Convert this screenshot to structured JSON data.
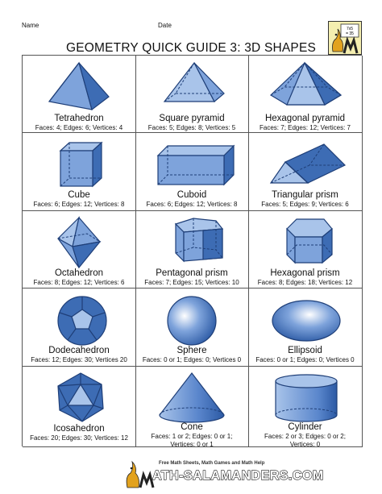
{
  "header": {
    "name_label": "Name",
    "date_label": "Date"
  },
  "title": "GEOMETRY QUICK GUIDE 3:  3D SHAPES",
  "shapes": [
    {
      "name": "Tetrahedron",
      "facts": [
        "Faces: 4; Edges: 6; Vertices: 4"
      ],
      "icon": "tetrahedron-icon"
    },
    {
      "name": "Square pyramid",
      "facts": [
        "Faces: 5; Edges: 8; Vertices: 5"
      ],
      "icon": "square-pyramid-icon"
    },
    {
      "name": "Hexagonal pyramid",
      "facts": [
        "Faces: 7; Edges: 12; Vertices: 7"
      ],
      "icon": "hexagonal-pyramid-icon"
    },
    {
      "name": "Cube",
      "facts": [
        "Faces: 6; Edges: 12; Vertices: 8"
      ],
      "icon": "cube-icon"
    },
    {
      "name": "Cuboid",
      "facts": [
        "Faces: 6; Edges: 12; Vertices: 8"
      ],
      "icon": "cuboid-icon"
    },
    {
      "name": "Triangular prism",
      "facts": [
        "Faces: 5; Edges: 9; Vertices: 6"
      ],
      "icon": "triangular-prism-icon"
    },
    {
      "name": "Octahedron",
      "facts": [
        "Faces: 8; Edges: 12; Vertices: 6"
      ],
      "icon": "octahedron-icon"
    },
    {
      "name": "Pentagonal prism",
      "facts": [
        "Faces: 7; Edges: 15; Vertices: 10"
      ],
      "icon": "pentagonal-prism-icon"
    },
    {
      "name": "Hexagonal prism",
      "facts": [
        "Faces: 8; Edges: 18; Vertices: 12"
      ],
      "icon": "hexagonal-prism-icon"
    },
    {
      "name": "Dodecahedron",
      "facts": [
        "Faces: 12; Edges: 30; Vertices 20"
      ],
      "icon": "dodecahedron-icon"
    },
    {
      "name": "Sphere",
      "facts": [
        "Faces: 0 or 1; Edges: 0; Vertices 0"
      ],
      "icon": "sphere-icon"
    },
    {
      "name": "Ellipsoid",
      "facts": [
        "Faces: 0 or 1; Edges: 0; Vertices 0"
      ],
      "icon": "ellipsoid-icon"
    },
    {
      "name": "Icosahedron",
      "facts": [
        "Faces: 20; Edges: 30; Vertices: 12"
      ],
      "icon": "icosahedron-icon"
    },
    {
      "name": "Cone",
      "facts": [
        "Faces: 1 or 2; Edges: 0 or 1;",
        "Vertices: 0 or 1"
      ],
      "icon": "cone-icon"
    },
    {
      "name": "Cylinder",
      "facts": [
        "Faces: 2 or 3; Edges: 0 or 2;",
        "Vertices: 0"
      ],
      "icon": "cylinder-icon"
    }
  ],
  "footer": {
    "tagline": "Free Math Sheets, Math Games and Math Help",
    "site": "ATH-SALAMANDERS.COM"
  },
  "logo": {
    "top_text": "7x5",
    "bottom_text": "= 35"
  },
  "colors": {
    "shape_light": "#a9c4ea",
    "shape_mid": "#7ea3db",
    "shape_dark": "#3d6cb4",
    "edge": "#1f3f78"
  }
}
